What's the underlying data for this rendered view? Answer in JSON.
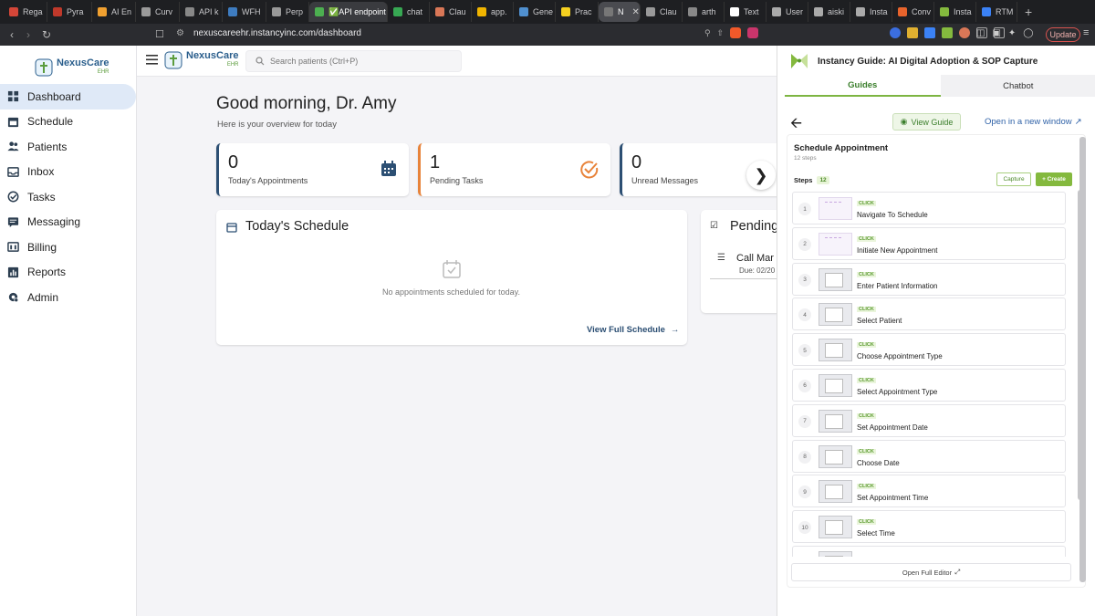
{
  "browser": {
    "tabs": [
      {
        "label": "Rega",
        "color": "#d44638"
      },
      {
        "label": "Pyra",
        "color": "#c0392b"
      },
      {
        "label": "AI En",
        "color": "#f0a030"
      },
      {
        "label": "Curv",
        "color": "#9a9a9a"
      },
      {
        "label": "API k",
        "color": "#888888"
      },
      {
        "label": "WFH",
        "color": "#3e7cc0"
      },
      {
        "label": "Perp",
        "color": "#999999"
      },
      {
        "label": "✅API endpoint Py",
        "color": "#4caf50"
      },
      {
        "label": "chat",
        "color": "#37a853"
      },
      {
        "label": "Clau",
        "color": "#d97757"
      },
      {
        "label": "app.",
        "color": "#f0b400"
      },
      {
        "label": "Gene",
        "color": "#5090d0"
      },
      {
        "label": "Prac",
        "color": "#f5d020"
      },
      {
        "label": "N",
        "color": "#777777"
      },
      {
        "label": "Clau",
        "color": "#999999"
      },
      {
        "label": "arth",
        "color": "#888888"
      },
      {
        "label": "Text",
        "color": "#ffffff"
      },
      {
        "label": "User",
        "color": "#aaaaaa"
      },
      {
        "label": "aiski",
        "color": "#aaaaaa"
      },
      {
        "label": "Insta",
        "color": "#aaaaaa"
      },
      {
        "label": "Conv",
        "color": "#e8642c"
      },
      {
        "label": "Insta",
        "color": "#84b93e"
      },
      {
        "label": "RTM",
        "color": "#3b82f6"
      }
    ],
    "url": "nexuscareehr.instancyinc.com/dashboard",
    "update_label": "Update"
  },
  "app": {
    "logo_name": "NexusCare",
    "logo_sub": "EHR",
    "search_placeholder": "Search patients (Ctrl+P)",
    "nav": [
      {
        "label": "Dashboard",
        "icon": "dashboard-icon"
      },
      {
        "label": "Schedule",
        "icon": "calendar-icon"
      },
      {
        "label": "Patients",
        "icon": "people-icon"
      },
      {
        "label": "Inbox",
        "icon": "inbox-icon"
      },
      {
        "label": "Tasks",
        "icon": "check-circle-icon"
      },
      {
        "label": "Messaging",
        "icon": "message-icon"
      },
      {
        "label": "Billing",
        "icon": "billing-icon"
      },
      {
        "label": "Reports",
        "icon": "reports-icon"
      },
      {
        "label": "Admin",
        "icon": "gear-icon"
      }
    ],
    "greeting": "Good morning, Dr. Amy",
    "subgreeting": "Here is your overview for today",
    "stats": [
      {
        "value": "0",
        "label": "Today's Appointments",
        "accent": "#2c4f73"
      },
      {
        "value": "1",
        "label": "Pending Tasks",
        "accent": "#e8833a"
      },
      {
        "value": "0",
        "label": "Unread Messages",
        "accent": "#2c4f73"
      }
    ],
    "schedule": {
      "title": "Today's Schedule",
      "empty": "No appointments scheduled for today.",
      "view_full": "View Full Schedule"
    },
    "pending": {
      "title": "Pending",
      "item": "Call Mar",
      "due": "Due: 02/20"
    }
  },
  "guide_panel": {
    "title": "Instancy Guide: AI Digital Adoption & SOP Capture",
    "tabs": [
      "Guides",
      "Chatbot"
    ],
    "view_guide": "View Guide",
    "open_new": "Open in a new window",
    "guide_title": "Schedule Appointment",
    "guide_sub": "12 steps",
    "steps_label": "Steps",
    "steps_count": "12",
    "capture": "Capture",
    "create": "+ Create",
    "action": "CLICK",
    "steps": [
      {
        "n": "1",
        "name": "Navigate To Schedule",
        "thumb": "light"
      },
      {
        "n": "2",
        "name": "Initiate New Appointment",
        "thumb": "light"
      },
      {
        "n": "3",
        "name": "Enter Patient Information",
        "thumb": "dark"
      },
      {
        "n": "4",
        "name": "Select Patient",
        "thumb": "dark"
      },
      {
        "n": "5",
        "name": "Choose Appointment Type",
        "thumb": "dark"
      },
      {
        "n": "6",
        "name": "Select Appointment Type",
        "thumb": "dark"
      },
      {
        "n": "7",
        "name": "Set Appointment Date",
        "thumb": "dark"
      },
      {
        "n": "8",
        "name": "Choose Date",
        "thumb": "dark"
      },
      {
        "n": "9",
        "name": "Set Appointment Time",
        "thumb": "dark"
      },
      {
        "n": "10",
        "name": "Select Time",
        "thumb": "dark"
      },
      {
        "n": "11",
        "name": "",
        "thumb": "dark"
      }
    ],
    "open_editor": "Open Full Editor"
  },
  "colors": {
    "brand_green": "#84b93e",
    "nav_active_bg": "#dfe9f7",
    "primary_blue": "#2c4f73"
  }
}
